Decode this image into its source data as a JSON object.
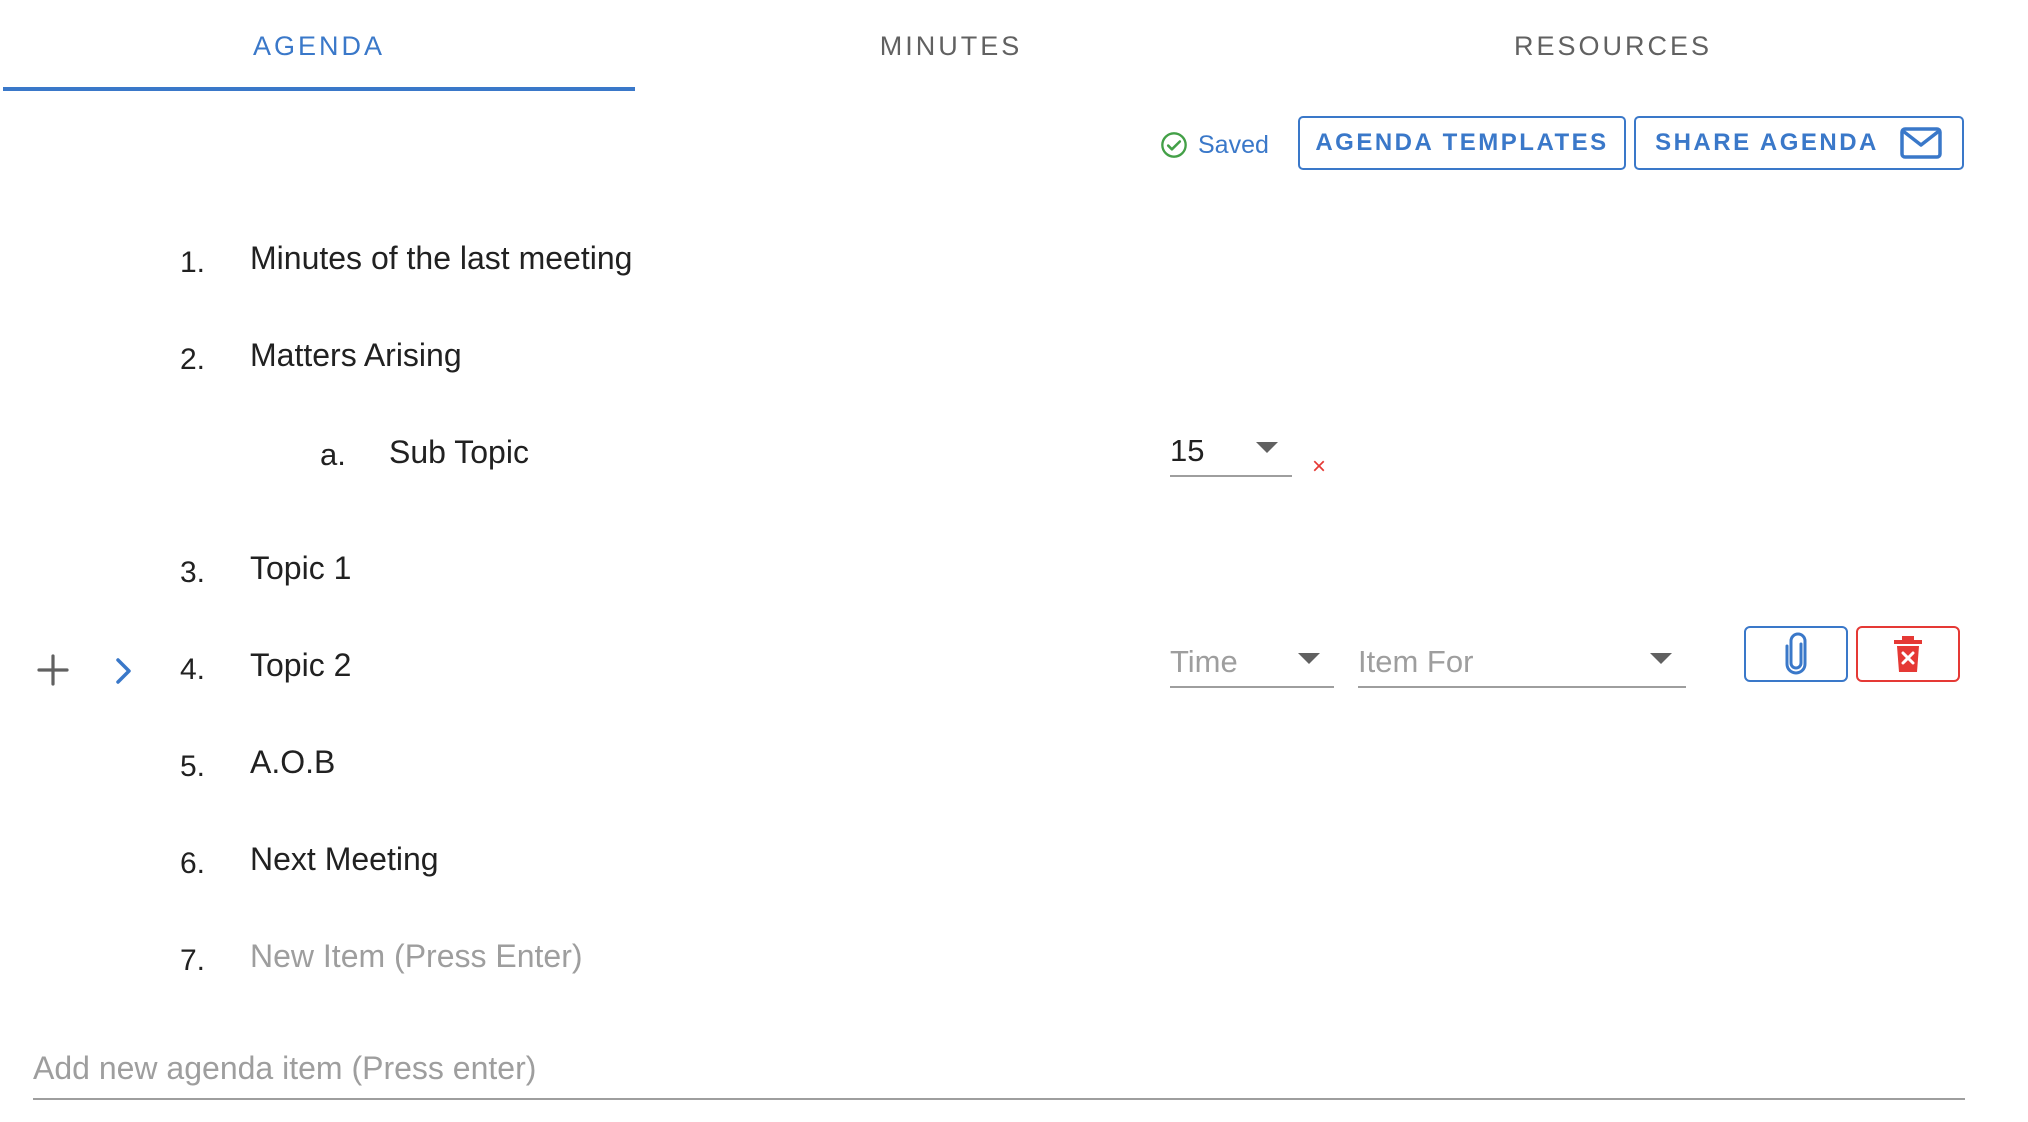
{
  "tabs": [
    {
      "label": "AGENDA",
      "active": true
    },
    {
      "label": "MINUTES",
      "active": false
    },
    {
      "label": "RESOURCES",
      "active": false
    }
  ],
  "toolbar": {
    "saved_label": "Saved",
    "templates_label": "AGENDA TEMPLATES",
    "share_label": "SHARE AGENDA"
  },
  "agenda": {
    "items": [
      {
        "number": "1.",
        "text": "Minutes of the last meeting"
      },
      {
        "number": "2.",
        "text": "Matters Arising"
      },
      {
        "number": "3.",
        "text": "Topic 1"
      },
      {
        "number": "4.",
        "text": "Topic 2"
      },
      {
        "number": "5.",
        "text": "A.O.B"
      },
      {
        "number": "6.",
        "text": "Next Meeting"
      },
      {
        "number": "7.",
        "placeholder": "New Item (Press Enter)"
      }
    ],
    "sub_item": {
      "letter": "a.",
      "text": "Sub Topic",
      "time_value": "15",
      "remove_symbol": "×"
    },
    "active_item": {
      "time_placeholder": "Time",
      "item_for_placeholder": "Item For"
    }
  },
  "new_agenda_placeholder": "Add new agenda item (Press enter)",
  "colors": {
    "accent": "#3a78c9",
    "danger": "#e53935",
    "saved": "#43a047",
    "muted": "#9e9e9e"
  },
  "icons": [
    "check-circle-icon",
    "mail-icon",
    "plus-icon",
    "chevron-right-icon",
    "paperclip-icon",
    "delete-icon",
    "dropdown-caret-icon"
  ]
}
